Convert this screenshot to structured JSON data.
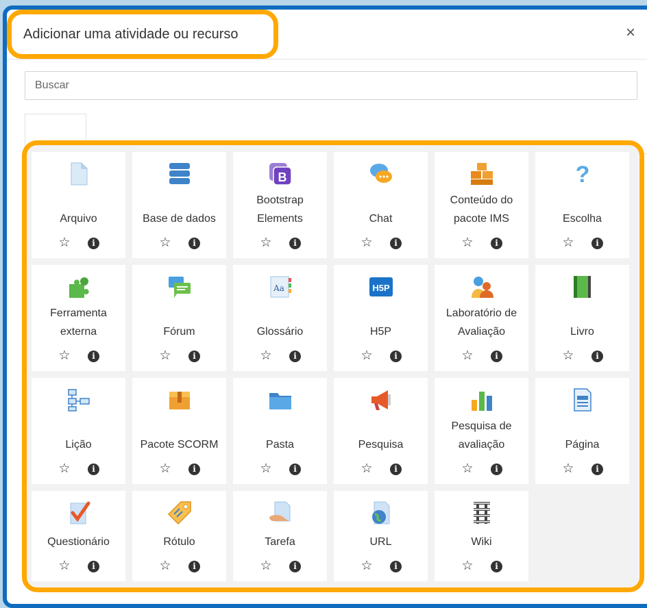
{
  "modal": {
    "title": "Adicionar uma atividade ou recurso",
    "close_label": "×"
  },
  "search": {
    "placeholder": "Buscar",
    "value": ""
  },
  "highlight_color": "#ffa800",
  "frame_color": "#0f6cbf",
  "star_glyph": "☆",
  "info_glyph": "i",
  "activities": [
    {
      "label": "Arquivo",
      "icon": "file-icon"
    },
    {
      "label": "Base de dados",
      "icon": "database-icon"
    },
    {
      "label": "Bootstrap Elements",
      "icon": "bootstrap-icon"
    },
    {
      "label": "Chat",
      "icon": "chat-icon"
    },
    {
      "label": "Conteúdo do pacote IMS",
      "icon": "ims-package-icon"
    },
    {
      "label": "Escolha",
      "icon": "question-mark-icon"
    },
    {
      "label": "Ferramenta externa",
      "icon": "puzzle-icon"
    },
    {
      "label": "Fórum",
      "icon": "forum-icon"
    },
    {
      "label": "Glossário",
      "icon": "glossary-icon"
    },
    {
      "label": "H5P",
      "icon": "h5p-icon"
    },
    {
      "label": "Laboratório de Avaliação",
      "icon": "workshop-icon"
    },
    {
      "label": "Livro",
      "icon": "book-icon"
    },
    {
      "label": "Lição",
      "icon": "lesson-icon"
    },
    {
      "label": "Pacote SCORM",
      "icon": "scorm-package-icon"
    },
    {
      "label": "Pasta",
      "icon": "folder-icon"
    },
    {
      "label": "Pesquisa",
      "icon": "megaphone-icon"
    },
    {
      "label": "Pesquisa de avaliação",
      "icon": "bar-chart-icon"
    },
    {
      "label": "Página",
      "icon": "page-icon"
    },
    {
      "label": "Questionário",
      "icon": "quiz-checkmark-icon"
    },
    {
      "label": "Rótulo",
      "icon": "label-tag-icon"
    },
    {
      "label": "Tarefa",
      "icon": "assignment-icon"
    },
    {
      "label": "URL",
      "icon": "url-globe-icon"
    },
    {
      "label": "Wiki",
      "icon": "wiki-icon"
    }
  ]
}
